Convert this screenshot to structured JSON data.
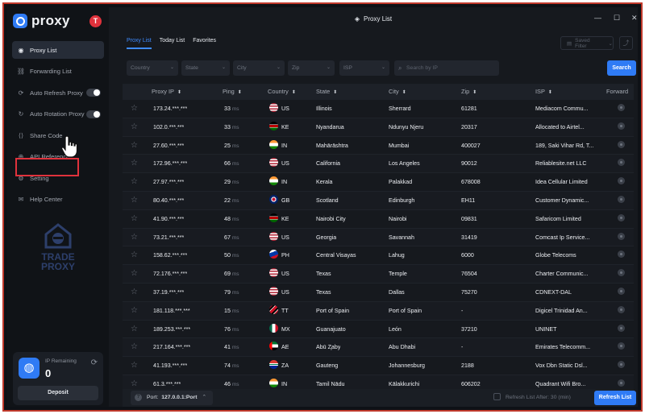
{
  "app": {
    "brand": "proxy",
    "avatar_initial": "T",
    "window_title": "Proxy List",
    "accent": "#2f7bf5",
    "highlight_color": "#e0323c"
  },
  "sidebar": {
    "items": [
      {
        "label": "Proxy List",
        "icon": "proxy-list-icon",
        "active": true
      },
      {
        "label": "Forwarding List",
        "icon": "link-icon"
      },
      {
        "label": "Auto Refresh Proxy",
        "icon": "refresh-icon",
        "toggle": true
      },
      {
        "label": "Auto Rotation Proxy",
        "icon": "rotation-icon",
        "toggle": true
      },
      {
        "label": "Share Code",
        "icon": "share-code-icon"
      },
      {
        "label": "API Reference",
        "icon": "api-icon"
      },
      {
        "label": "Setting",
        "icon": "gear-icon"
      },
      {
        "label": "Help Center",
        "icon": "help-icon"
      }
    ],
    "logo_text": "TRADE PROXY",
    "ip_remaining_label": "IP Remaining",
    "ip_remaining_value": "0",
    "deposit_label": "Deposit"
  },
  "main": {
    "tabs": [
      "Proxy List",
      "Today List",
      "Favorites"
    ],
    "saved_filter_label": "Saved Filter",
    "filters": [
      "Country",
      "State",
      "City",
      "Zip",
      "ISP"
    ],
    "search_placeholder": "Search by IP",
    "search_button": "Search",
    "columns": [
      "Proxy IP",
      "Ping",
      "Country",
      "State",
      "City",
      "Zip",
      "ISP",
      "Forward"
    ],
    "ping_unit": "ms",
    "rows": [
      {
        "ip": "173.24.***.***",
        "ping": "33",
        "country": "US",
        "state": "Illinois",
        "city": "Sherrard",
        "zip": "61281",
        "isp": "Mediacom Commu..."
      },
      {
        "ip": "102.0.***.***",
        "ping": "33",
        "country": "KE",
        "state": "Nyandarua",
        "city": "Ndunyu Njeru",
        "zip": "20317",
        "isp": "Allocated to Airtel..."
      },
      {
        "ip": "27.60.***.***",
        "ping": "25",
        "country": "IN",
        "state": "Mahārāshtra",
        "city": "Mumbai",
        "zip": "400027",
        "isp": "189, Saki Vihar Rd, T..."
      },
      {
        "ip": "172.96.***.***",
        "ping": "66",
        "country": "US",
        "state": "California",
        "city": "Los Angeles",
        "zip": "90012",
        "isp": "Reliablesite.net LLC"
      },
      {
        "ip": "27.97.***.***",
        "ping": "29",
        "country": "IN",
        "state": "Kerala",
        "city": "Palakkad",
        "zip": "678008",
        "isp": "Idea Cellular Limited"
      },
      {
        "ip": "80.40.***.***",
        "ping": "22",
        "country": "GB",
        "state": "Scotland",
        "city": "Edinburgh",
        "zip": "EH11",
        "isp": "Customer Dynamic..."
      },
      {
        "ip": "41.90.***.***",
        "ping": "48",
        "country": "KE",
        "state": "Nairobi City",
        "city": "Nairobi",
        "zip": "09831",
        "isp": "Safaricom Limited"
      },
      {
        "ip": "73.21.***.***",
        "ping": "67",
        "country": "US",
        "state": "Georgia",
        "city": "Savannah",
        "zip": "31419",
        "isp": "Comcast Ip Service..."
      },
      {
        "ip": "158.62.***.***",
        "ping": "50",
        "country": "PH",
        "state": "Central Visayas",
        "city": "Lahug",
        "zip": "6000",
        "isp": "Globe Telecoms"
      },
      {
        "ip": "72.176.***.***",
        "ping": "69",
        "country": "US",
        "state": "Texas",
        "city": "Temple",
        "zip": "76504",
        "isp": "Charter Communic..."
      },
      {
        "ip": "37.19.***.***",
        "ping": "79",
        "country": "US",
        "state": "Texas",
        "city": "Dallas",
        "zip": "75270",
        "isp": "CDNEXT-DAL"
      },
      {
        "ip": "181.118.***.***",
        "ping": "15",
        "country": "TT",
        "state": "Port of Spain",
        "city": "Port of Spain",
        "zip": "-",
        "isp": "Digicel Trinidad An..."
      },
      {
        "ip": "189.253.***.***",
        "ping": "76",
        "country": "MX",
        "state": "Guanajuato",
        "city": "León",
        "zip": "37210",
        "isp": "UNINET"
      },
      {
        "ip": "217.164.***.***",
        "ping": "41",
        "country": "AE",
        "state": "Abū Z̧aby",
        "city": "Abu Dhabi",
        "zip": "-",
        "isp": "Emirates Telecomm..."
      },
      {
        "ip": "41.193.***.***",
        "ping": "74",
        "country": "ZA",
        "state": "Gauteng",
        "city": "Johannesburg",
        "zip": "2188",
        "isp": "Vox Dbn Static Dsl..."
      },
      {
        "ip": "61.3.***.***",
        "ping": "46",
        "country": "IN",
        "state": "Tamil Nādu",
        "city": "Kālakkurichi",
        "zip": "606202",
        "isp": "Quadrant Wifi Bro..."
      }
    ],
    "port_label": "Port:",
    "port_value": "127.0.0.1:Port",
    "refresh_after_label": "Refresh List After: 30 (min)",
    "refresh_button": "Refresh List"
  }
}
